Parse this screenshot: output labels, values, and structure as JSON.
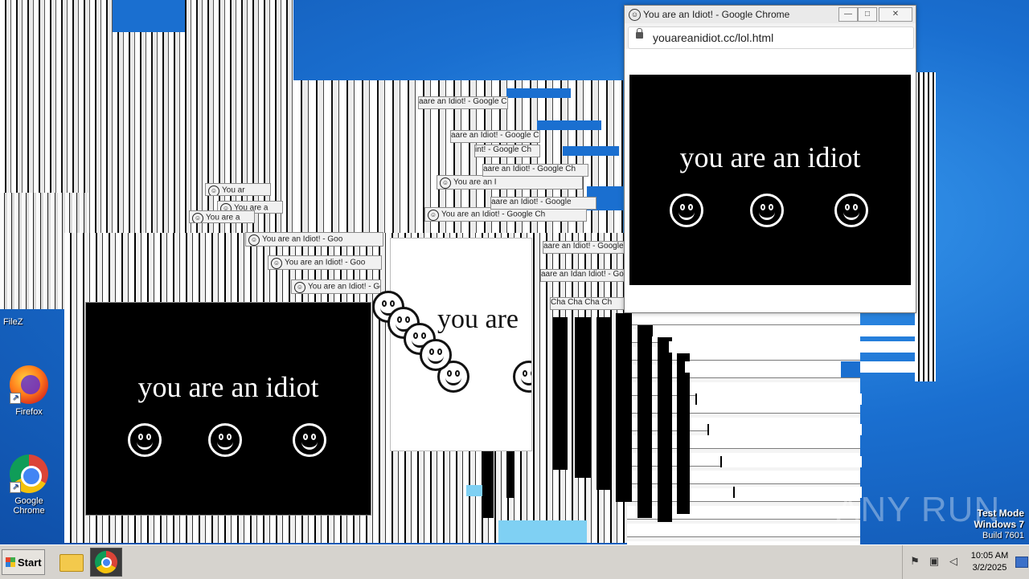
{
  "desktop": {
    "icons": [
      {
        "label": "Firefox",
        "icon": "firefox-icon"
      },
      {
        "label": "Google Chrome",
        "icon": "chrome-icon"
      }
    ],
    "partial_label": "FileZ"
  },
  "trail_windows": {
    "title_full": "You are an Idiot! - Google Chrome",
    "title_short": "You are an Idiot! - Goo",
    "title_frag_1": "You are an Idiot! - Google Ch",
    "title_frag_2": "You are an Idiot! - Google Chr",
    "title_frag_3": "aare an Idiot! - Google Ch",
    "title_frag_4": "aare an Idan Idiot! - Goo",
    "title_frag_5": "Cha Cha Cha Ch",
    "title_frag_6": "You are an I",
    "title_frag_7": "You are a",
    "title_frag_8": "You ar",
    "title_frag_9": "aare an Idiot! - Google",
    "title_frag_10": "int! - Google Ch",
    "title_frag_11": "aare an Idiot! - Google Ch"
  },
  "panel_left": {
    "text": "you are an idiot",
    "faces": [
      "smiley-face",
      "smiley-face",
      "smiley-face"
    ]
  },
  "panel_middle": {
    "text": "you are"
  },
  "chrome_popup": {
    "title": "You are an Idiot! - Google Chrome",
    "url": "youareanidiot.cc/lol.html",
    "controls": {
      "minimize": "—",
      "maximize": "□",
      "close": "✕"
    },
    "content_text": "you are an idiot",
    "faces": [
      "smiley-face",
      "smiley-face",
      "smiley-face"
    ]
  },
  "taskbar": {
    "start_label": "Start",
    "pinned": [
      "explorer-icon",
      "chrome-icon"
    ],
    "clock_time": "10:05 AM",
    "clock_date": "3/2/2025",
    "tray_icons": [
      "flag-icon",
      "network-icon",
      "volume-icon"
    ]
  },
  "watermark": {
    "brand": "ANY RUN",
    "line1": "Test Mode",
    "line2": "Windows 7",
    "line3": "Build 7601"
  },
  "colors": {
    "desktop_blue": "#1a6fd0",
    "panel_black": "#000000",
    "taskbar_gray": "#d6d3ce"
  }
}
